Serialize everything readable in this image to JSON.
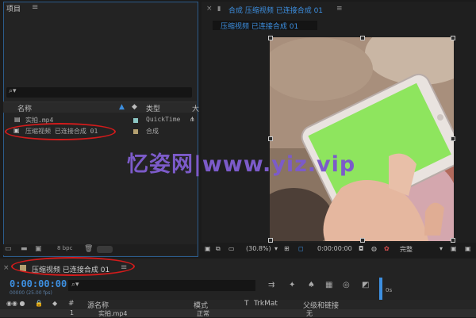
{
  "project_panel": {
    "title": "项目",
    "menu_icon": "≡",
    "columns": {
      "name": "名称",
      "type": "类型",
      "extra": "大"
    },
    "items": [
      {
        "name": "实拍.mp4",
        "type": "QuickTime",
        "label_color": "#8cc7c4"
      },
      {
        "name": "压缩视频 已连接合成 01",
        "type": "合成",
        "label_color": "#b4a070"
      }
    ],
    "bpc": "8 bpc"
  },
  "viewer": {
    "lock_icon": "🔒",
    "tab_title": "合成 压缩视频 已连接合成 01",
    "subtab": "压缩视频 已连接合成 01",
    "zoom": "(30.8%)",
    "timecode": "0:00:00:00",
    "quality": "完整"
  },
  "timeline": {
    "tab_title": "压缩视频 已连接合成 01",
    "timecode": "0:00:00:00",
    "fps": "00000 (25.00 fps)",
    "ruler_start": "0s",
    "columns": {
      "number": "#",
      "source": "源名称",
      "mode": "模式",
      "t": "T",
      "trkmat": "TrkMat",
      "parent": "父级和链接"
    },
    "row": {
      "index": "1",
      "source": "实拍.mp4",
      "mode": "正常",
      "parent": "无"
    }
  },
  "watermark": "忆姿网|www.yiz.vip",
  "colors": {
    "accent": "#3d8fe0",
    "annotation": "#d31b1b",
    "watermark": "#7c5bc9",
    "screen_green": "#8ee55e"
  }
}
